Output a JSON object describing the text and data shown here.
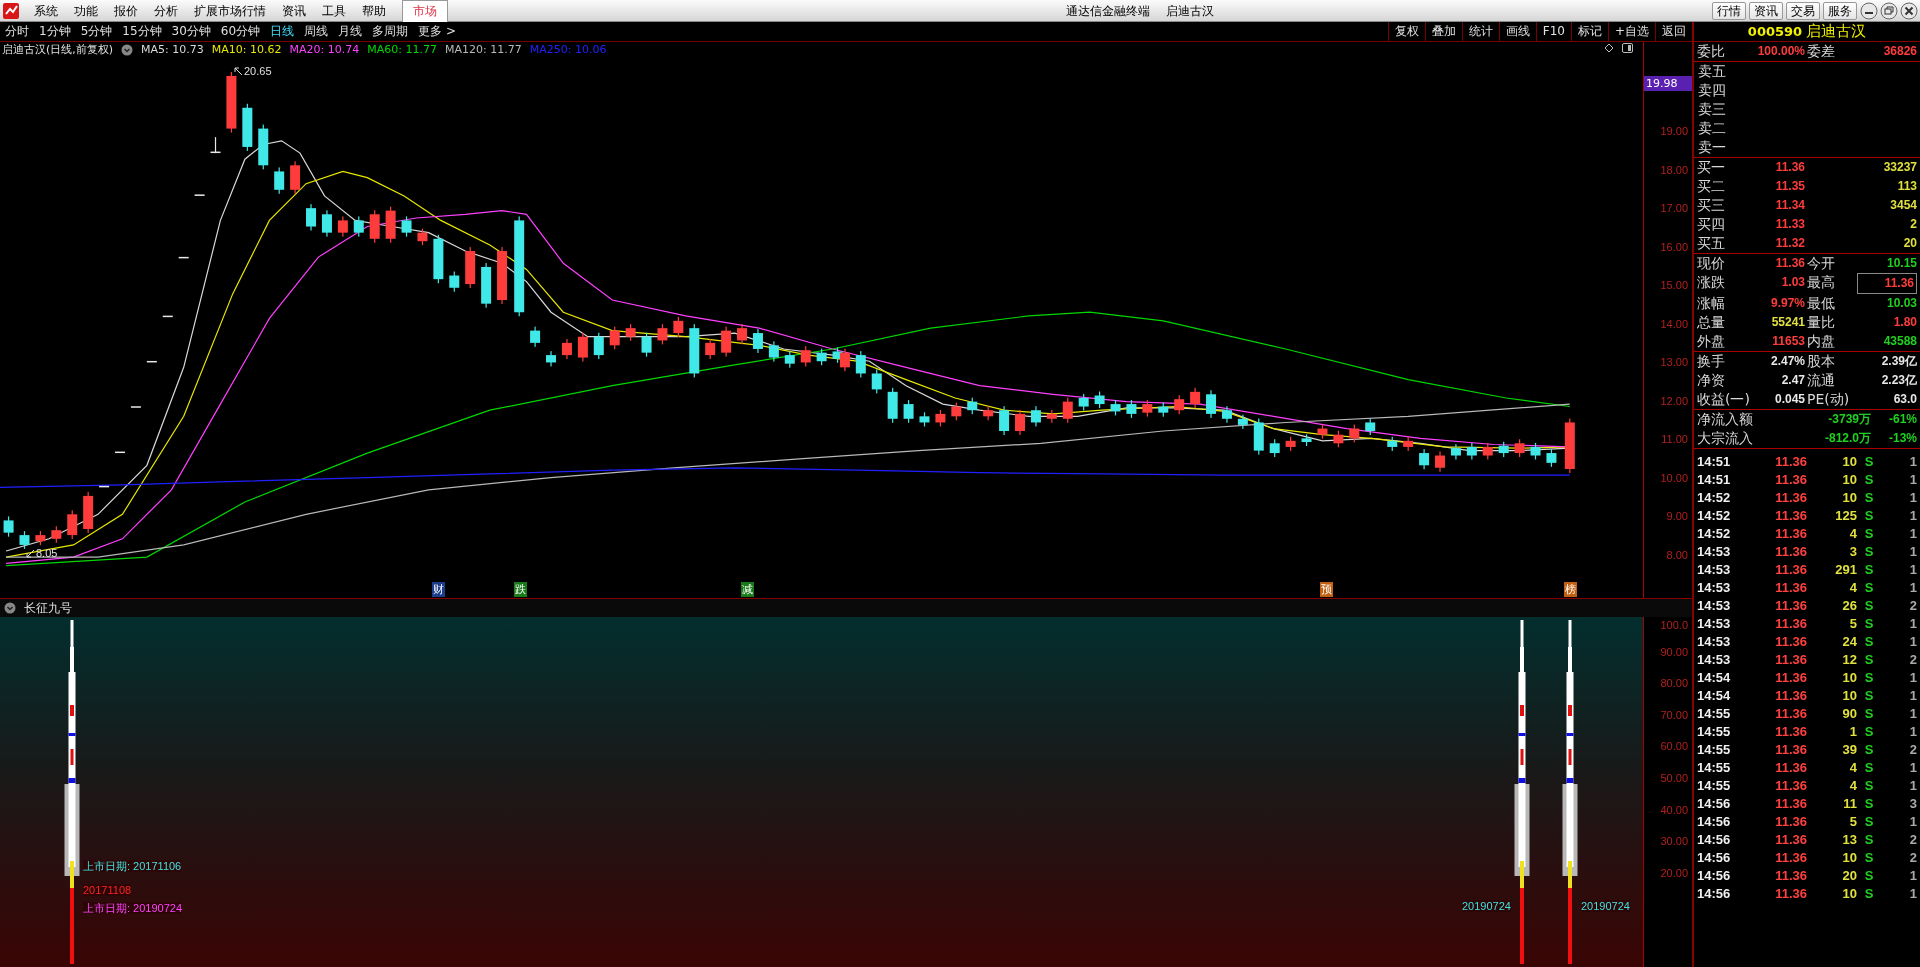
{
  "window": {
    "app_title": "通达信金融终端",
    "stock_title": "启迪古汉"
  },
  "menu": {
    "items": [
      "系统",
      "功能",
      "报价",
      "分析",
      "扩展市场行情",
      "资讯",
      "工具",
      "帮助"
    ],
    "market_tab": {
      "label": "市场",
      "selected": true
    }
  },
  "title_buttons": [
    "行情",
    "资讯",
    "交易",
    "服务"
  ],
  "periods": [
    {
      "label": "分时",
      "selected": false
    },
    {
      "label": "1分钟",
      "selected": false
    },
    {
      "label": "5分钟",
      "selected": false
    },
    {
      "label": "15分钟",
      "selected": false
    },
    {
      "label": "30分钟",
      "selected": false
    },
    {
      "label": "60分钟",
      "selected": false
    },
    {
      "label": "日线",
      "selected": true
    },
    {
      "label": "周线",
      "selected": false
    },
    {
      "label": "月线",
      "selected": false
    },
    {
      "label": "多周期",
      "selected": false
    },
    {
      "label": "更多 >",
      "selected": false
    }
  ],
  "chart_tools": [
    "复权",
    "叠加",
    "统计",
    "画线",
    "F10",
    "标记",
    "+自选",
    "返回"
  ],
  "main_chart": {
    "title": "启迪古汉(日线,前复权)",
    "ma_legend": [
      {
        "label": "MA5: 10.73",
        "color": "#d8d8d8"
      },
      {
        "label": "MA10: 10.62",
        "color": "#e8e800"
      },
      {
        "label": "MA20: 10.74",
        "color": "#ff40ff"
      },
      {
        "label": "MA60: 11.77",
        "color": "#00d800"
      },
      {
        "label": "MA120: 11.77",
        "color": "#b8b8b8"
      },
      {
        "label": "MA250: 10.06",
        "color": "#2020ff"
      }
    ],
    "high_label": "20.65",
    "low_label": "8.05",
    "price_tag": "19.98",
    "axis_labels": [
      "19.00",
      "18.00",
      "17.00",
      "16.00",
      "15.00",
      "14.00",
      "13.00",
      "12.00",
      "11.00",
      "10.00",
      "9.00",
      "8.00"
    ],
    "event_marks": [
      {
        "label": "财",
        "color": "#1c3c8c"
      },
      {
        "label": "跌",
        "color": "#1a7a1a"
      },
      {
        "label": "减",
        "color": "#1a7a1a"
      },
      {
        "label": "预",
        "color": "#c06010"
      },
      {
        "label": "榜",
        "color": "#c06010"
      }
    ]
  },
  "indicator": {
    "title": "长征九号",
    "axis_labels": [
      "100.0",
      "90.00",
      "80.00",
      "70.00",
      "60.00",
      "50.00",
      "40.00",
      "30.00",
      "20.00"
    ],
    "notes": [
      {
        "text": "上市日期: 20171106",
        "color": "#40e0e0"
      },
      {
        "text": "20171108",
        "color": "#ff2020"
      },
      {
        "text": "上市日期: 20190724",
        "color": "#ff40ff"
      },
      {
        "text": "20190724",
        "color": "#40e0e0"
      },
      {
        "text": "20190724",
        "color": "#40e0e0"
      }
    ]
  },
  "quote": {
    "code": "000590",
    "name": "启迪古汉",
    "order_ratio": [
      {
        "label": "委比",
        "value": "100.00%"
      },
      {
        "label": "委差",
        "value": "36826"
      }
    ],
    "asks": [
      "卖五",
      "卖四",
      "卖三",
      "卖二",
      "卖一"
    ],
    "bids": [
      {
        "label": "买一",
        "price": "11.36",
        "volume": "33237"
      },
      {
        "label": "买二",
        "price": "11.35",
        "volume": "113"
      },
      {
        "label": "买三",
        "price": "11.34",
        "volume": "3454"
      },
      {
        "label": "买四",
        "price": "11.33",
        "volume": "2"
      },
      {
        "label": "买五",
        "price": "11.32",
        "volume": "20"
      }
    ],
    "stats": [
      {
        "label": "现价",
        "value": "11.36",
        "color": "#ff3c3c",
        "boxed": false
      },
      {
        "label": "今开",
        "value": "10.15",
        "color": "#20d020",
        "boxed": false
      },
      {
        "label": "涨跌",
        "value": "1.03",
        "color": "#ff3c3c",
        "boxed": false
      },
      {
        "label": "最高",
        "value": "11.36",
        "color": "#ff3c3c",
        "boxed": true
      },
      {
        "label": "涨幅",
        "value": "9.97%",
        "color": "#ff3c3c",
        "boxed": false
      },
      {
        "label": "最低",
        "value": "10.03",
        "color": "#20d020",
        "boxed": false
      },
      {
        "label": "总量",
        "value": "55241",
        "color": "#e0e040",
        "boxed": false
      },
      {
        "label": "量比",
        "value": "1.80",
        "color": "#ff3c3c",
        "boxed": false
      },
      {
        "label": "外盘",
        "value": "11653",
        "color": "#ff3c3c",
        "boxed": false
      },
      {
        "label": "内盘",
        "value": "43588",
        "color": "#20d020",
        "boxed": false
      }
    ],
    "fundamentals": [
      {
        "label": "换手",
        "value": "2.47%"
      },
      {
        "label": "股本",
        "value": "2.39亿"
      },
      {
        "label": "净资",
        "value": "2.47"
      },
      {
        "label": "流通",
        "value": "2.23亿"
      },
      {
        "label": "收益(一)",
        "value": "0.045"
      },
      {
        "label": "PE(动)",
        "value": "63.0"
      }
    ],
    "flows": [
      {
        "label": "净流入额",
        "amount": "-3739万",
        "percent": "-61%"
      },
      {
        "label": "大宗流入",
        "amount": "-812.0万",
        "percent": "-13%"
      }
    ]
  },
  "trades": [
    {
      "time": "14:51",
      "price": "11.36",
      "volume": "10",
      "side": "S",
      "count": "1"
    },
    {
      "time": "14:51",
      "price": "11.36",
      "volume": "10",
      "side": "S",
      "count": "1"
    },
    {
      "time": "14:52",
      "price": "11.36",
      "volume": "10",
      "side": "S",
      "count": "1"
    },
    {
      "time": "14:52",
      "price": "11.36",
      "volume": "125",
      "side": "S",
      "count": "1"
    },
    {
      "time": "14:52",
      "price": "11.36",
      "volume": "4",
      "side": "S",
      "count": "1"
    },
    {
      "time": "14:53",
      "price": "11.36",
      "volume": "3",
      "side": "S",
      "count": "1"
    },
    {
      "time": "14:53",
      "price": "11.36",
      "volume": "291",
      "side": "S",
      "count": "1"
    },
    {
      "time": "14:53",
      "price": "11.36",
      "volume": "4",
      "side": "S",
      "count": "1"
    },
    {
      "time": "14:53",
      "price": "11.36",
      "volume": "26",
      "side": "S",
      "count": "2"
    },
    {
      "time": "14:53",
      "price": "11.36",
      "volume": "5",
      "side": "S",
      "count": "1"
    },
    {
      "time": "14:53",
      "price": "11.36",
      "volume": "24",
      "side": "S",
      "count": "1"
    },
    {
      "time": "14:53",
      "price": "11.36",
      "volume": "12",
      "side": "S",
      "count": "2"
    },
    {
      "time": "14:54",
      "price": "11.36",
      "volume": "10",
      "side": "S",
      "count": "1"
    },
    {
      "time": "14:54",
      "price": "11.36",
      "volume": "10",
      "side": "S",
      "count": "1"
    },
    {
      "time": "14:55",
      "price": "11.36",
      "volume": "90",
      "side": "S",
      "count": "1"
    },
    {
      "time": "14:55",
      "price": "11.36",
      "volume": "1",
      "side": "S",
      "count": "1"
    },
    {
      "time": "14:55",
      "price": "11.36",
      "volume": "39",
      "side": "S",
      "count": "2"
    },
    {
      "time": "14:55",
      "price": "11.36",
      "volume": "4",
      "side": "S",
      "count": "1"
    },
    {
      "time": "14:55",
      "price": "11.36",
      "volume": "4",
      "side": "S",
      "count": "1"
    },
    {
      "time": "14:56",
      "price": "11.36",
      "volume": "11",
      "side": "S",
      "count": "3"
    },
    {
      "time": "14:56",
      "price": "11.36",
      "volume": "5",
      "side": "S",
      "count": "1"
    },
    {
      "time": "14:56",
      "price": "11.36",
      "volume": "13",
      "side": "S",
      "count": "2"
    },
    {
      "time": "14:56",
      "price": "11.36",
      "volume": "10",
      "side": "S",
      "count": "2"
    },
    {
      "time": "14:56",
      "price": "11.36",
      "volume": "20",
      "side": "S",
      "count": "1"
    },
    {
      "time": "14:56",
      "price": "11.36",
      "volume": "10",
      "side": "S",
      "count": "1"
    }
  ]
}
